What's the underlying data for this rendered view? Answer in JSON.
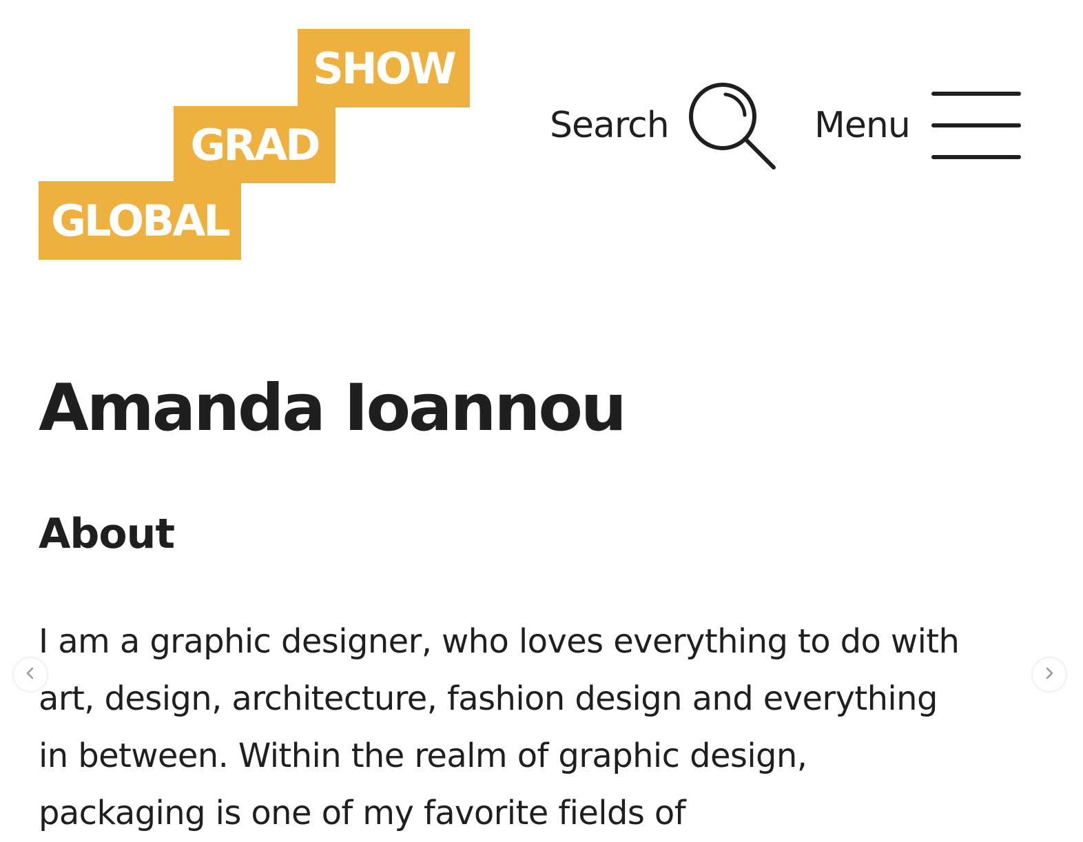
{
  "colors": {
    "accent": "#eeb13f",
    "text": "#1f1f1f",
    "background": "#ffffff"
  },
  "logo": {
    "line1": "SHOW",
    "line2": "GRAD",
    "line3": "GLOBAL"
  },
  "header": {
    "search_label": "Search",
    "search_icon": "magnifier-icon",
    "menu_label": "Menu",
    "menu_icon": "hamburger-icon"
  },
  "profile": {
    "name": "Amanda Ioannou",
    "about_heading": "About",
    "about_lines": [
      "I am a graphic designer, who loves everything to do with",
      "art, design, architecture, fashion design and everything",
      "in between. Within the realm of graphic design,",
      "packaging is one of my favorite fields of"
    ]
  },
  "carousel": {
    "prev_icon": "chevron-left-icon",
    "next_icon": "chevron-right-icon"
  }
}
